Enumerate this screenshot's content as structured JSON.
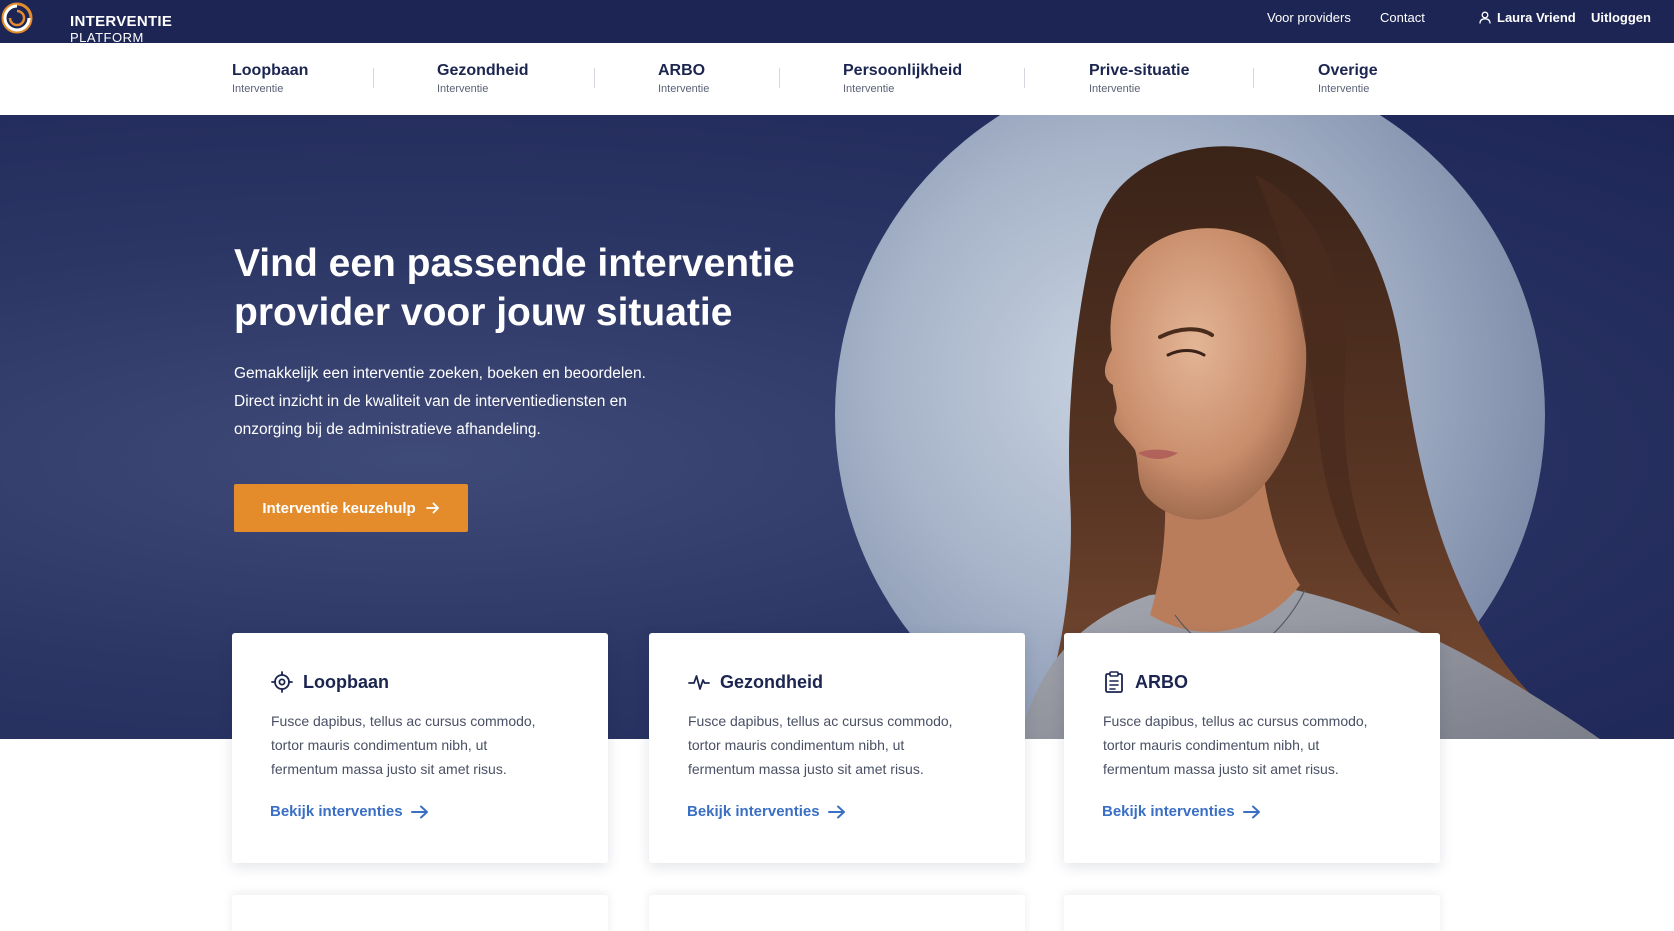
{
  "brand": {
    "line1": "INTERVENTIE",
    "line2": "PLATFORM"
  },
  "top_links": {
    "providers": "Voor providers",
    "contact": "Contact",
    "user": "Laura Vriend",
    "logout": "Uitloggen"
  },
  "nav": {
    "items": [
      {
        "title": "Loopbaan",
        "sub": "Interventie"
      },
      {
        "title": "Gezondheid",
        "sub": "Interventie"
      },
      {
        "title": "ARBO",
        "sub": "Interventie"
      },
      {
        "title": "Persoonlijkheid",
        "sub": "Interventie"
      },
      {
        "title": "Prive-situatie",
        "sub": "Interventie"
      },
      {
        "title": "Overige",
        "sub": "Interventie"
      }
    ]
  },
  "hero": {
    "title_line1": "Vind een passende interventie",
    "title_line2": "provider voor jouw situatie",
    "desc_line1": "Gemakkelijk een interventie zoeken, boeken en beoordelen.",
    "desc_line2": "Direct inzicht in de kwaliteit van de interventiediensten en",
    "desc_line3": "onzorging bij de administratieve afhandeling.",
    "button": "Interventie keuzehulp"
  },
  "cards": [
    {
      "title": "Loopbaan",
      "icon": "target-icon",
      "line1": "Fusce dapibus, tellus ac cursus commodo,",
      "line2": "tortor mauris condimentum nibh, ut",
      "line3": "fermentum massa justo sit amet risus.",
      "link": "Bekijk interventies"
    },
    {
      "title": "Gezondheid",
      "icon": "pulse-icon",
      "line1": "Fusce dapibus, tellus ac cursus commodo,",
      "line2": "tortor mauris condimentum nibh, ut",
      "line3": "fermentum massa justo sit amet risus.",
      "link": "Bekijk interventies"
    },
    {
      "title": "ARBO",
      "icon": "clipboard-icon",
      "line1": "Fusce dapibus, tellus ac cursus commodo,",
      "line2": "tortor mauris condimentum nibh, ut",
      "line3": "fermentum massa justo sit amet risus.",
      "link": "Bekijk interventies"
    }
  ],
  "colors": {
    "navy": "#1c2554",
    "accent_orange": "#e48c2c",
    "link_blue": "#3a6fc4"
  }
}
